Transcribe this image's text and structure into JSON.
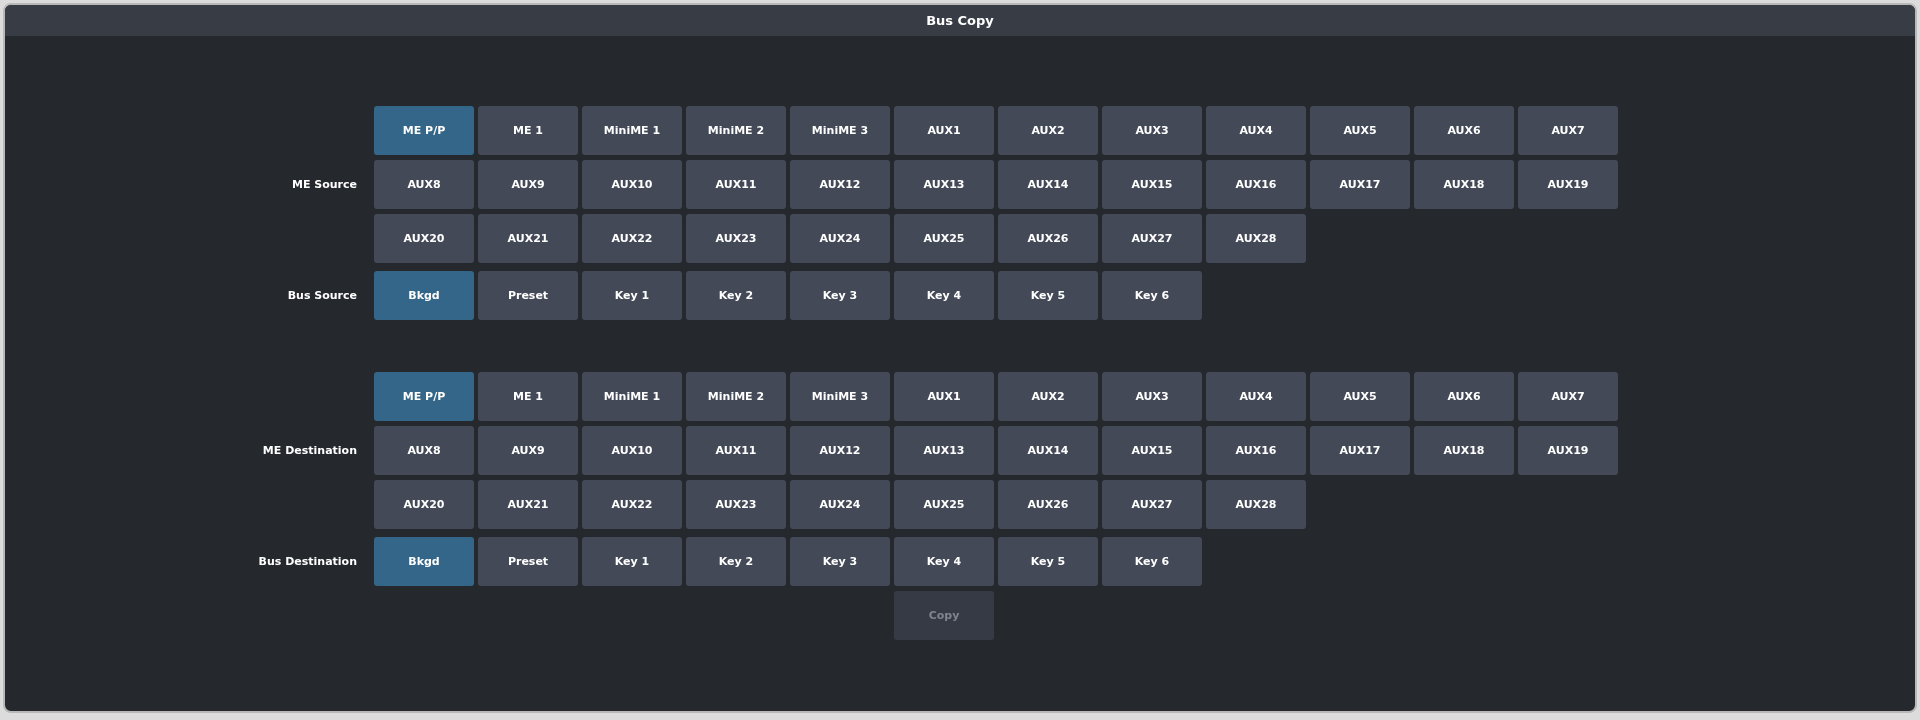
{
  "window": {
    "title": "Bus Copy"
  },
  "groups": [
    {
      "label": "ME Source",
      "buttons": [
        {
          "label": "ME P/P",
          "selected": true
        },
        {
          "label": "ME 1",
          "selected": false
        },
        {
          "label": "MiniME 1",
          "selected": false
        },
        {
          "label": "MiniME 2",
          "selected": false
        },
        {
          "label": "MiniME 3",
          "selected": false
        },
        {
          "label": "AUX1",
          "selected": false
        },
        {
          "label": "AUX2",
          "selected": false
        },
        {
          "label": "AUX3",
          "selected": false
        },
        {
          "label": "AUX4",
          "selected": false
        },
        {
          "label": "AUX5",
          "selected": false
        },
        {
          "label": "AUX6",
          "selected": false
        },
        {
          "label": "AUX7",
          "selected": false
        },
        {
          "label": "AUX8",
          "selected": false
        },
        {
          "label": "AUX9",
          "selected": false
        },
        {
          "label": "AUX10",
          "selected": false
        },
        {
          "label": "AUX11",
          "selected": false
        },
        {
          "label": "AUX12",
          "selected": false
        },
        {
          "label": "AUX13",
          "selected": false
        },
        {
          "label": "AUX14",
          "selected": false
        },
        {
          "label": "AUX15",
          "selected": false
        },
        {
          "label": "AUX16",
          "selected": false
        },
        {
          "label": "AUX17",
          "selected": false
        },
        {
          "label": "AUX18",
          "selected": false
        },
        {
          "label": "AUX19",
          "selected": false
        },
        {
          "label": "AUX20",
          "selected": false
        },
        {
          "label": "AUX21",
          "selected": false
        },
        {
          "label": "AUX22",
          "selected": false
        },
        {
          "label": "AUX23",
          "selected": false
        },
        {
          "label": "AUX24",
          "selected": false
        },
        {
          "label": "AUX25",
          "selected": false
        },
        {
          "label": "AUX26",
          "selected": false
        },
        {
          "label": "AUX27",
          "selected": false
        },
        {
          "label": "AUX28",
          "selected": false
        }
      ]
    },
    {
      "label": "Bus Source",
      "buttons": [
        {
          "label": "Bkgd",
          "selected": true
        },
        {
          "label": "Preset",
          "selected": false
        },
        {
          "label": "Key 1",
          "selected": false
        },
        {
          "label": "Key 2",
          "selected": false
        },
        {
          "label": "Key 3",
          "selected": false
        },
        {
          "label": "Key 4",
          "selected": false
        },
        {
          "label": "Key 5",
          "selected": false
        },
        {
          "label": "Key 6",
          "selected": false
        }
      ]
    },
    {
      "label": "ME Destination",
      "buttons": [
        {
          "label": "ME P/P",
          "selected": true
        },
        {
          "label": "ME 1",
          "selected": false
        },
        {
          "label": "MiniME 1",
          "selected": false
        },
        {
          "label": "MiniME 2",
          "selected": false
        },
        {
          "label": "MiniME 3",
          "selected": false
        },
        {
          "label": "AUX1",
          "selected": false
        },
        {
          "label": "AUX2",
          "selected": false
        },
        {
          "label": "AUX3",
          "selected": false
        },
        {
          "label": "AUX4",
          "selected": false
        },
        {
          "label": "AUX5",
          "selected": false
        },
        {
          "label": "AUX6",
          "selected": false
        },
        {
          "label": "AUX7",
          "selected": false
        },
        {
          "label": "AUX8",
          "selected": false
        },
        {
          "label": "AUX9",
          "selected": false
        },
        {
          "label": "AUX10",
          "selected": false
        },
        {
          "label": "AUX11",
          "selected": false
        },
        {
          "label": "AUX12",
          "selected": false
        },
        {
          "label": "AUX13",
          "selected": false
        },
        {
          "label": "AUX14",
          "selected": false
        },
        {
          "label": "AUX15",
          "selected": false
        },
        {
          "label": "AUX16",
          "selected": false
        },
        {
          "label": "AUX17",
          "selected": false
        },
        {
          "label": "AUX18",
          "selected": false
        },
        {
          "label": "AUX19",
          "selected": false
        },
        {
          "label": "AUX20",
          "selected": false
        },
        {
          "label": "AUX21",
          "selected": false
        },
        {
          "label": "AUX22",
          "selected": false
        },
        {
          "label": "AUX23",
          "selected": false
        },
        {
          "label": "AUX24",
          "selected": false
        },
        {
          "label": "AUX25",
          "selected": false
        },
        {
          "label": "AUX26",
          "selected": false
        },
        {
          "label": "AUX27",
          "selected": false
        },
        {
          "label": "AUX28",
          "selected": false
        }
      ]
    },
    {
      "label": "Bus Destination",
      "buttons": [
        {
          "label": "Bkgd",
          "selected": true
        },
        {
          "label": "Preset",
          "selected": false
        },
        {
          "label": "Key 1",
          "selected": false
        },
        {
          "label": "Key 2",
          "selected": false
        },
        {
          "label": "Key 3",
          "selected": false
        },
        {
          "label": "Key 4",
          "selected": false
        },
        {
          "label": "Key 5",
          "selected": false
        },
        {
          "label": "Key 6",
          "selected": false
        }
      ]
    }
  ],
  "copy_button": {
    "label": "Copy",
    "disabled": true
  }
}
